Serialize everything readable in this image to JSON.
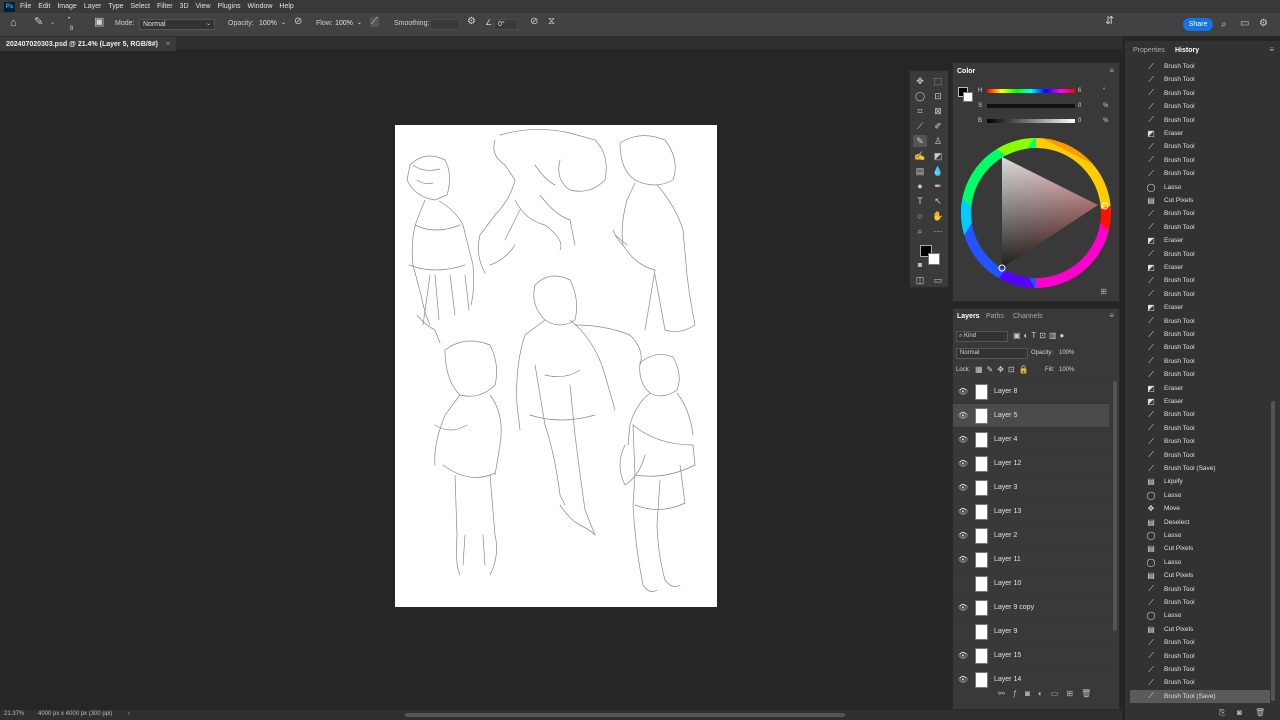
{
  "app": {
    "logo": "Ps"
  },
  "menu": [
    "File",
    "Edit",
    "Image",
    "Layer",
    "Type",
    "Select",
    "Filter",
    "3D",
    "View",
    "Plugins",
    "Window",
    "Help"
  ],
  "options_bar": {
    "brush_size": "8",
    "mode_label": "Mode:",
    "mode_value": "Normal",
    "opacity_label": "Opacity:",
    "opacity_value": "100%",
    "flow_label": "Flow:",
    "flow_value": "100%",
    "smoothing_label": "Smoothing:",
    "angle_value": "0°",
    "share_label": "Share"
  },
  "document": {
    "tab_title": "202407020303.psd @ 21.4% (Layer 5, RGB/8#)",
    "close_glyph": "×"
  },
  "status": {
    "zoom": "21.37%",
    "info": "4000 px x 4000 px (300 ppi)",
    "arrow": "›"
  },
  "color_panel": {
    "tab": "Color",
    "h_label": "H",
    "h_value": "6",
    "h_unit": "°",
    "s_label": "S",
    "s_value": "0",
    "s_unit": "%",
    "b_label": "B",
    "b_value": "0",
    "b_unit": "%"
  },
  "layers_panel": {
    "tabs": [
      "Layers",
      "Paths",
      "Channels"
    ],
    "filter_kind": "Kind",
    "blend_mode": "Normal",
    "opacity_label": "Opacity:",
    "opacity_value": "100%",
    "lock_label": "Lock:",
    "fill_label": "Fill:",
    "fill_value": "100%",
    "layers": [
      {
        "name": "Layer 8",
        "visible": true,
        "selected": false
      },
      {
        "name": "Layer 5",
        "visible": true,
        "selected": true
      },
      {
        "name": "Layer 4",
        "visible": true,
        "selected": false
      },
      {
        "name": "Layer 12",
        "visible": true,
        "selected": false
      },
      {
        "name": "Layer 3",
        "visible": true,
        "selected": false
      },
      {
        "name": "Layer 13",
        "visible": true,
        "selected": false
      },
      {
        "name": "Layer 2",
        "visible": true,
        "selected": false
      },
      {
        "name": "Layer 11",
        "visible": true,
        "selected": false
      },
      {
        "name": "Layer 10",
        "visible": false,
        "selected": false
      },
      {
        "name": "Layer 9 copy",
        "visible": true,
        "selected": false
      },
      {
        "name": "Layer 9",
        "visible": false,
        "selected": false
      },
      {
        "name": "Layer 15",
        "visible": true,
        "selected": false
      },
      {
        "name": "Layer 14",
        "visible": true,
        "selected": false
      }
    ],
    "footer_icons": [
      "link-icon",
      "fx-icon",
      "mask-icon",
      "adjustment-icon",
      "group-icon",
      "new-layer-icon",
      "trash-icon"
    ]
  },
  "right_dock": {
    "tabs": [
      "Properties",
      "History"
    ],
    "active_tab": "History",
    "history": [
      {
        "label": "Brush Tool",
        "icon": "brush"
      },
      {
        "label": "Brush Tool",
        "icon": "brush"
      },
      {
        "label": "Brush Tool",
        "icon": "brush"
      },
      {
        "label": "Brush Tool",
        "icon": "brush"
      },
      {
        "label": "Brush Tool",
        "icon": "brush"
      },
      {
        "label": "Eraser",
        "icon": "eraser"
      },
      {
        "label": "Brush Tool",
        "icon": "brush"
      },
      {
        "label": "Brush Tool",
        "icon": "brush"
      },
      {
        "label": "Brush Tool",
        "icon": "brush"
      },
      {
        "label": "Lasso",
        "icon": "lasso"
      },
      {
        "label": "Cut Pixels",
        "icon": "doc"
      },
      {
        "label": "Brush Tool",
        "icon": "brush"
      },
      {
        "label": "Brush Tool",
        "icon": "brush"
      },
      {
        "label": "Eraser",
        "icon": "eraser"
      },
      {
        "label": "Brush Tool",
        "icon": "brush"
      },
      {
        "label": "Eraser",
        "icon": "eraser"
      },
      {
        "label": "Brush Tool",
        "icon": "brush"
      },
      {
        "label": "Brush Tool",
        "icon": "brush"
      },
      {
        "label": "Eraser",
        "icon": "eraser"
      },
      {
        "label": "Brush Tool",
        "icon": "brush"
      },
      {
        "label": "Brush Tool",
        "icon": "brush"
      },
      {
        "label": "Brush Tool",
        "icon": "brush"
      },
      {
        "label": "Brush Tool",
        "icon": "brush"
      },
      {
        "label": "Brush Tool",
        "icon": "brush"
      },
      {
        "label": "Eraser",
        "icon": "eraser"
      },
      {
        "label": "Eraser",
        "icon": "eraser"
      },
      {
        "label": "Brush Tool",
        "icon": "brush"
      },
      {
        "label": "Brush Tool",
        "icon": "brush"
      },
      {
        "label": "Brush Tool",
        "icon": "brush"
      },
      {
        "label": "Brush Tool",
        "icon": "brush"
      },
      {
        "label": "Brush Tool (Save)",
        "icon": "brush"
      },
      {
        "label": "Liquify",
        "icon": "doc"
      },
      {
        "label": "Lasso",
        "icon": "lasso"
      },
      {
        "label": "Move",
        "icon": "move"
      },
      {
        "label": "Deselect",
        "icon": "doc"
      },
      {
        "label": "Lasso",
        "icon": "lasso"
      },
      {
        "label": "Cut Pixels",
        "icon": "doc"
      },
      {
        "label": "Lasso",
        "icon": "lasso"
      },
      {
        "label": "Cut Pixels",
        "icon": "doc"
      },
      {
        "label": "Brush Tool",
        "icon": "brush"
      },
      {
        "label": "Brush Tool",
        "icon": "brush"
      },
      {
        "label": "Lasso",
        "icon": "lasso"
      },
      {
        "label": "Cut Pixels",
        "icon": "doc"
      },
      {
        "label": "Brush Tool",
        "icon": "brush"
      },
      {
        "label": "Brush Tool",
        "icon": "brush"
      },
      {
        "label": "Brush Tool",
        "icon": "brush"
      },
      {
        "label": "Brush Tool",
        "icon": "brush"
      },
      {
        "label": "Brush Tool (Save)",
        "icon": "brush"
      }
    ],
    "selected_index": 47
  },
  "colors": {
    "accent": "#1473e6",
    "foreground": "#000000",
    "background": "#ffffff"
  }
}
